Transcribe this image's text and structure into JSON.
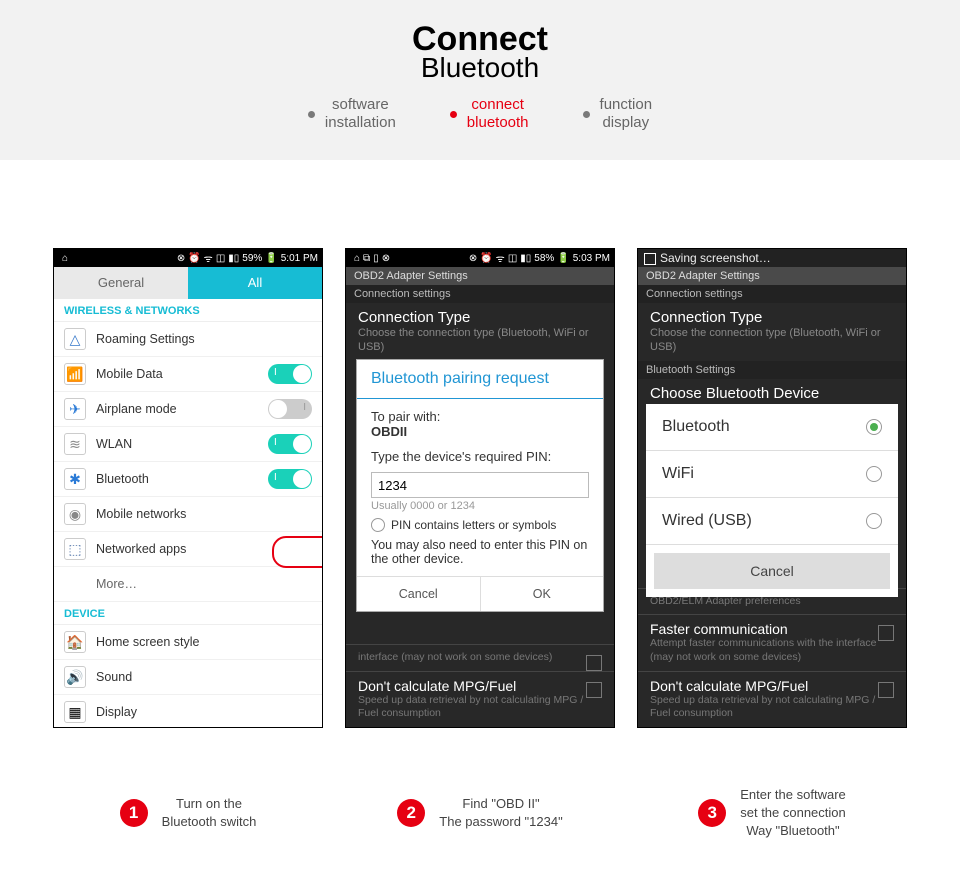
{
  "header": {
    "title_line1": "Connect",
    "title_line2": "Bluetooth",
    "nav": [
      {
        "label": "software\ninstallation",
        "active": false
      },
      {
        "label": "connect\nbluetooth",
        "active": true
      },
      {
        "label": "function\ndisplay",
        "active": false
      }
    ]
  },
  "phone1": {
    "status": {
      "batt": "59%",
      "time": "5:01 PM"
    },
    "tabs": {
      "general": "General",
      "all": "All"
    },
    "section_wn": "WIRELESS & NETWORKS",
    "items": [
      {
        "icon": "△",
        "label": "Roaming Settings",
        "toggle": null,
        "color": "#3577c9"
      },
      {
        "icon": "📶",
        "label": "Mobile Data",
        "toggle": "on",
        "color": "#5aa"
      },
      {
        "icon": "✈",
        "label": "Airplane mode",
        "toggle": "off",
        "color": "#2a7ad6"
      },
      {
        "icon": "≋",
        "label": "WLAN",
        "toggle": "on",
        "color": "#888"
      },
      {
        "icon": "✱",
        "label": "Bluetooth",
        "toggle": "on",
        "color": "#2a7ad6",
        "hl": true
      },
      {
        "icon": "◉",
        "label": "Mobile networks",
        "toggle": null,
        "color": "#888"
      },
      {
        "icon": "⬚",
        "label": "Networked apps",
        "toggle": null,
        "color": "#5577aa"
      }
    ],
    "more": "More…",
    "section_dev": "DEVICE",
    "dev_items": [
      {
        "icon": "🏠",
        "label": "Home screen style"
      },
      {
        "icon": "🔊",
        "label": "Sound"
      },
      {
        "icon": "▦",
        "label": "Display"
      }
    ]
  },
  "phone2": {
    "status": {
      "batt": "58%",
      "time": "5:03 PM"
    },
    "obd_header": "OBD2 Adapter Settings",
    "conn_settings": "Connection settings",
    "ct_title": "Connection Type",
    "ct_sub": "Choose the connection type (Bluetooth, WiFi or USB)",
    "dialog": {
      "title": "Bluetooth pairing request",
      "pair_label": "To pair with:",
      "pair_device": "OBDII",
      "pin_label": "Type the device's required PIN:",
      "pin_value": "1234",
      "pin_hint": "Usually 0000 or 1234",
      "pin_check": "PIN contains letters or symbols",
      "note": "You may also need to enter this PIN on the other device.",
      "cancel": "Cancel",
      "ok": "OK"
    },
    "under": [
      {
        "t": "",
        "s": "interface (may not work on some devices)"
      },
      {
        "t": "Don't calculate MPG/Fuel",
        "s": "Speed up data retrieval by not calculating MPG / Fuel consumption"
      }
    ]
  },
  "phone3": {
    "saving": "Saving screenshot…",
    "obd_header": "OBD2 Adapter Settings",
    "conn_settings": "Connection settings",
    "ct_title": "Connection Type",
    "ct_sub": "Choose the connection type (Bluetooth, WiFi or USB)",
    "bt_settings": "Bluetooth Settings",
    "choose_dev": "Choose Bluetooth Device",
    "radios": [
      {
        "label": "Bluetooth",
        "selected": true
      },
      {
        "label": "WiFi",
        "selected": false
      },
      {
        "label": "Wired (USB)",
        "selected": false
      }
    ],
    "cancel": "Cancel",
    "under": [
      {
        "t": "",
        "s": "OBD2/ELM Adapter preferences"
      },
      {
        "t": "Faster communication",
        "s": "Attempt faster communications with the interface (may not work on some devices)"
      },
      {
        "t": "Don't calculate MPG/Fuel",
        "s": "Speed up data retrieval by not calculating MPG / Fuel consumption"
      }
    ]
  },
  "captions": [
    {
      "num": "1",
      "text": "Turn on the\nBluetooth switch"
    },
    {
      "num": "2",
      "text": "Find  \"OBD II\"\nThe password \"1234\""
    },
    {
      "num": "3",
      "text": "Enter the software\nset the connection\nWay \"Bluetooth\""
    }
  ]
}
